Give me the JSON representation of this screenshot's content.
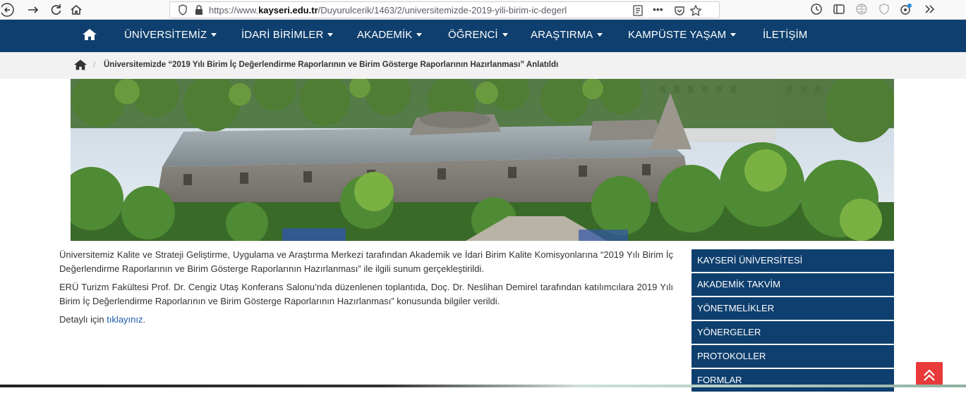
{
  "browser": {
    "url_prefix": "https://www.",
    "url_host": "kayseri.edu.tr",
    "url_path": "/Duyurulcerik/1463/2/universitemizde-2019-yili-birim-ic-degerl",
    "more_label": "•••"
  },
  "nav": {
    "items": [
      {
        "label": "ÜNİVERSİTEMİZ",
        "dropdown": true
      },
      {
        "label": "İDARİ BİRİMLER",
        "dropdown": true
      },
      {
        "label": "AKADEMİK",
        "dropdown": true
      },
      {
        "label": "ÖĞRENCİ",
        "dropdown": true
      },
      {
        "label": "ARAŞTIRMA",
        "dropdown": true
      },
      {
        "label": "KAMPÜSTE YAŞAM",
        "dropdown": true
      },
      {
        "label": "İLETİŞİM",
        "dropdown": false
      }
    ]
  },
  "breadcrumb": {
    "separator": "/",
    "title": "Üniversitemizde “2019 Yılı Birim İç Değerlendirme Raporlarının ve Birim Gösterge Raporlarının Hazırlanması” Anlatıldı"
  },
  "article": {
    "p1": "Üniversitemiz Kalite ve Strateji Geliştirme, Uygulama ve Araştırma Merkezi tarafından Akademik ve İdari Birim Kalite Komisyonlarına “2019 Yılı Birim İç Değerlendirme Raporlarının ve Birim Gösterge Raporlarının Hazırlanması” ile ilgili sunum gerçekleştirildi.",
    "p2": "ERÜ Turizm Fakültesi Prof. Dr. Cengiz Utaş Konferans Salonu’nda  düzenlenen toplantıda, Doç. Dr. Neslihan Demirel tarafından katılımcılara 2019 Yılı Birim İç Değerlendirme Raporlarının ve Birim Gösterge Raporlarının Hazırlanması” konusunda bilgiler verildi.",
    "details_prefix": "Detaylı için ",
    "details_link": "tıklayınız."
  },
  "sidebar": {
    "items": [
      {
        "label": "KAYSERİ ÜNİVERSİTESİ"
      },
      {
        "label": "AKADEMİK TAKVİM"
      },
      {
        "label": "YÖNETMELİKLER"
      },
      {
        "label": "YÖNERGELER"
      },
      {
        "label": "PROTOKOLLER"
      },
      {
        "label": "FORMLAR"
      }
    ]
  },
  "colors": {
    "nav_bg": "#0f3f6e",
    "sidebar_bg": "#0f3f6e",
    "to_top_bg": "#e83a3a",
    "link": "#1a5aa8"
  },
  "icons": [
    "back-icon",
    "forward-icon",
    "reload-icon",
    "home-icon",
    "shield-icon",
    "lock-icon",
    "reader-view-icon",
    "page-actions-icon",
    "pocket-icon",
    "bookmark-star-icon",
    "history-icon",
    "sidebar-icon",
    "extension-icon",
    "scroll-top-icon"
  ]
}
